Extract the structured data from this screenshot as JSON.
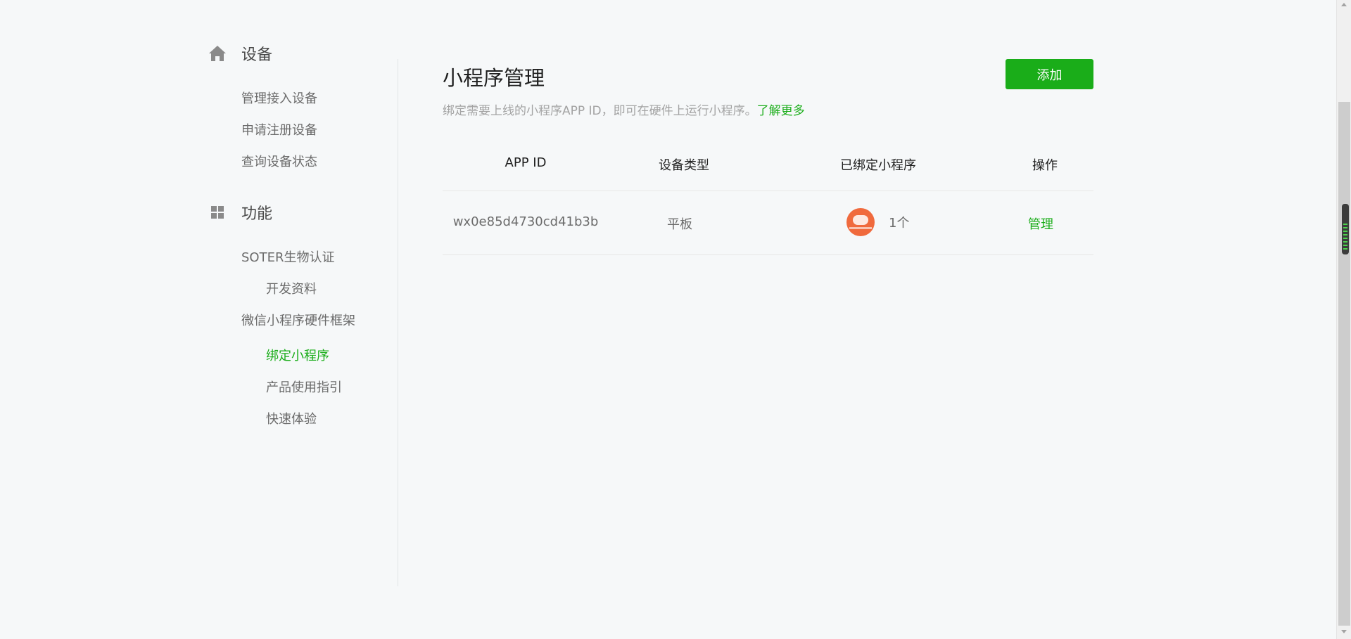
{
  "sidebar": {
    "device_section": {
      "icon": "home-icon",
      "title": "设备",
      "items": [
        "管理接入设备",
        "申请注册设备",
        "查询设备状态"
      ]
    },
    "function_section": {
      "icon": "grid-icon",
      "title": "功能",
      "items": [
        {
          "label": "SOTER生物认证"
        },
        {
          "label": "开发资料"
        },
        {
          "label": "微信小程序硬件框架"
        },
        {
          "label": "绑定小程序",
          "active": true
        },
        {
          "label": "产品使用指引"
        },
        {
          "label": "快速体验"
        }
      ]
    }
  },
  "main": {
    "title": "小程序管理",
    "add_label": "添加",
    "description": "绑定需要上线的小程序APP ID，即可在硬件上运行小程序。",
    "more_link": "了解更多",
    "table": {
      "headers": [
        "APP ID",
        "设备类型",
        "已绑定小程序",
        "操作"
      ],
      "rows": [
        {
          "app_id": "wx0e85d4730cd41b3b",
          "device_type": "平板",
          "bound_count": "1个",
          "action": "管理"
        }
      ]
    }
  },
  "colors": {
    "accent": "#1aad19",
    "background": "#f6f8f9",
    "avatar": "#f06a3d"
  }
}
